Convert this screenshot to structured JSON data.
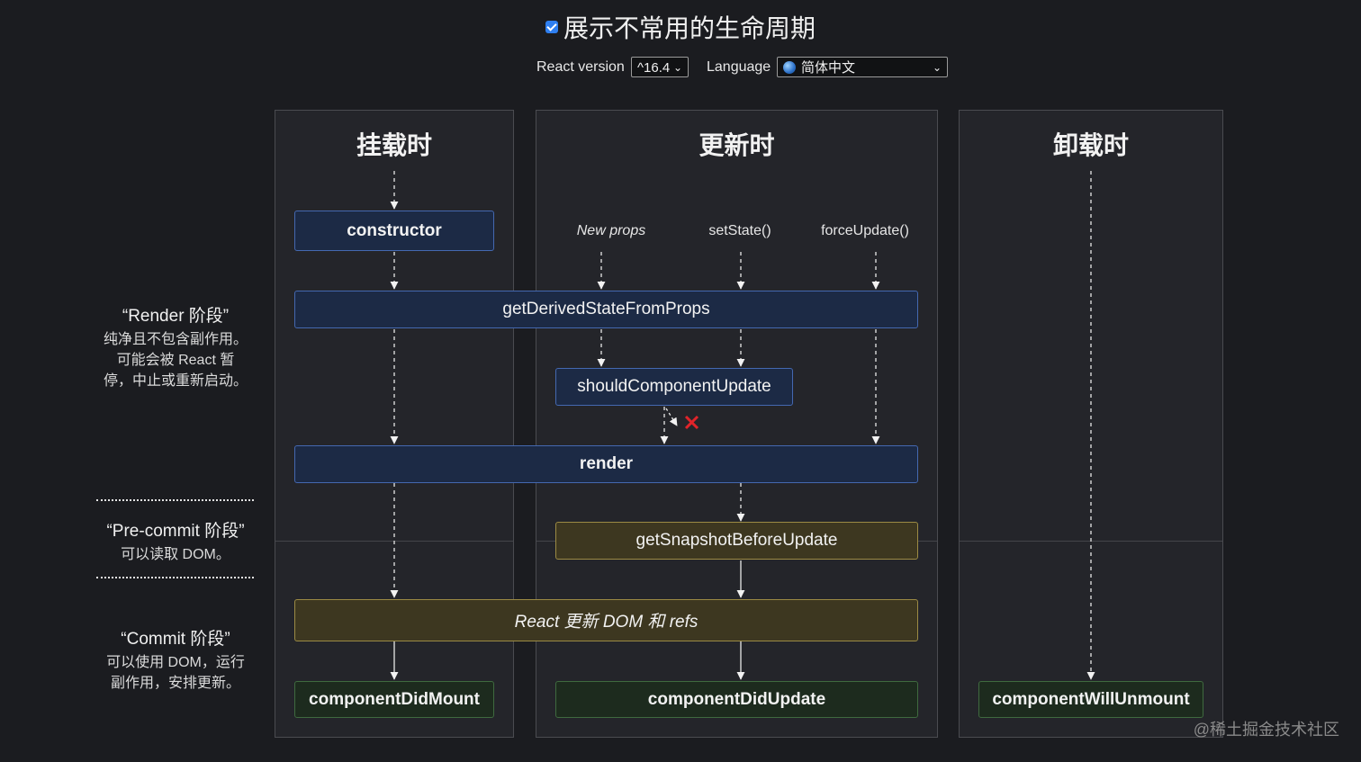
{
  "header": {
    "title": "展示不常用的生命周期",
    "show_rare_checked": true,
    "react_version_label": "React version",
    "react_version_value": "^16.4",
    "language_label": "Language",
    "language_value": "简体中文"
  },
  "phases": {
    "render": {
      "title": "“Render 阶段”",
      "desc": [
        "纯净且不包含副作用。",
        "可能会被 React 暂",
        "停，中止或重新启动。"
      ]
    },
    "precommit": {
      "title": "“Pre-commit 阶段”",
      "desc": [
        "可以读取 DOM。"
      ]
    },
    "commit": {
      "title": "“Commit 阶段”",
      "desc": [
        "可以使用 DOM，运行",
        "副作用，安排更新。"
      ]
    }
  },
  "columns": {
    "mount": {
      "title": "挂载时"
    },
    "update": {
      "title": "更新时",
      "triggers": [
        "New props",
        "setState()",
        "forceUpdate()"
      ]
    },
    "unmount": {
      "title": "卸载时"
    }
  },
  "methods": {
    "constructor": "constructor",
    "getDerivedStateFromProps": "getDerivedStateFromProps",
    "shouldComponentUpdate": "shouldComponentUpdate",
    "render": "render",
    "getSnapshotBeforeUpdate": "getSnapshotBeforeUpdate",
    "react_updates_dom": "React 更新 DOM 和 refs",
    "componentDidMount": "componentDidMount",
    "componentDidUpdate": "componentDidUpdate",
    "componentWillUnmount": "componentWillUnmount"
  },
  "watermark": "@稀土掘金技术社区",
  "colors": {
    "background": "#1b1c20",
    "column": "#24252a",
    "render_phase_box": "#1c2a45",
    "precommit_box": "#3d3720",
    "commit_box": "#1d2b1e",
    "cancel_x": "#e0242a"
  }
}
